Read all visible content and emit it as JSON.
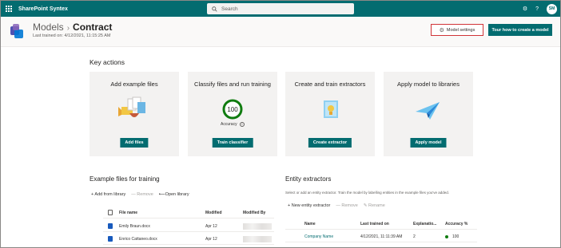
{
  "topbar": {
    "app_name": "SharePoint Syntex",
    "search_placeholder": "Search",
    "avatar_initials": "SM"
  },
  "header": {
    "breadcrumb_parent": "Models",
    "breadcrumb_separator": "›",
    "breadcrumb_current": "Contract",
    "last_trained": "Last trained on: 4/12/2021, 11:15:25 AM",
    "model_settings_label": "Model settings",
    "tour_label": "Tour how to create a model"
  },
  "key_actions": {
    "heading": "Key actions",
    "cards": [
      {
        "title": "Add example files",
        "button": "Add files"
      },
      {
        "title": "Classify files and run training",
        "button": "Train classifier",
        "accuracy_value": "100",
        "accuracy_label": "Accuracy"
      },
      {
        "title": "Create and train extractors",
        "button": "Create extractor"
      },
      {
        "title": "Apply model to libraries",
        "button": "Apply model"
      }
    ]
  },
  "example_files": {
    "heading": "Example files for training",
    "commands": {
      "add": "+ Add from library",
      "remove": "— Remove",
      "open": "⟵Open library"
    },
    "columns": [
      "File name",
      "Modified",
      "Modified By"
    ],
    "rows": [
      {
        "name": "Emily Braun.docx",
        "modified": "Apr 12"
      },
      {
        "name": "Enrico Cattaneo.docx",
        "modified": "Apr 12"
      }
    ]
  },
  "entity_extractors": {
    "heading": "Entity extractors",
    "subtitle": "Select or add an entity extractor. Train the model by labelling entities in the example files you've added.",
    "commands": {
      "new": "+ New entity extractor",
      "remove": "— Remove",
      "rename": "Rename"
    },
    "columns": [
      "Name",
      "Last trained on",
      "Explanatio...",
      "Accuracy %"
    ],
    "rows": [
      {
        "name": "Company Name",
        "last_trained": "4/12/2021, 11:11:39 AM",
        "explanations": "2",
        "accuracy": "100"
      }
    ]
  },
  "colors": {
    "accent": "#036c70",
    "highlight_border": "#d13438",
    "success": "#107c10"
  }
}
